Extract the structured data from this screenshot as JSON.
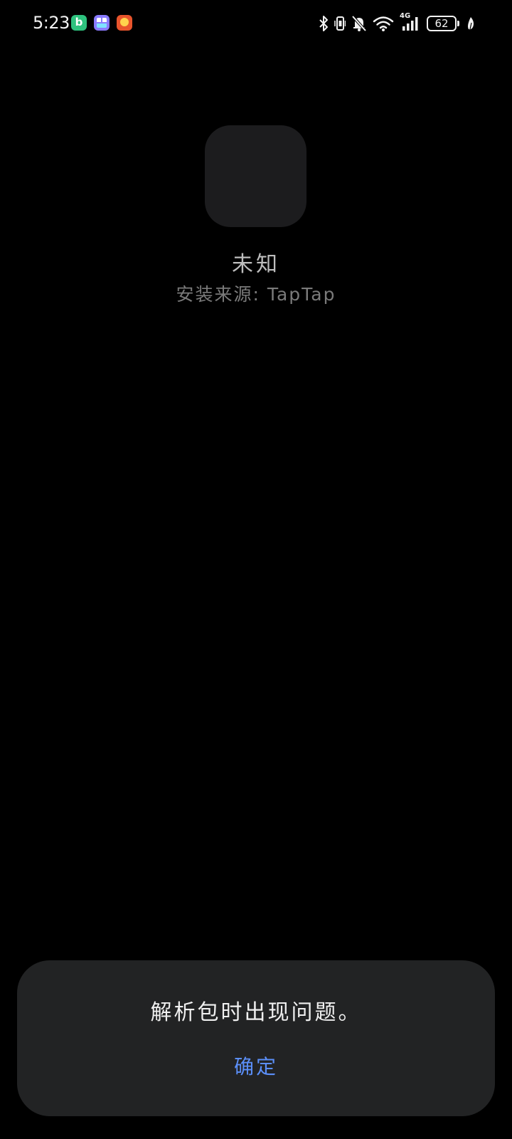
{
  "status_bar": {
    "time": "5:23",
    "notification_icons": [
      "bilibili-icon",
      "gallery-app-icon",
      "game-app-icon"
    ],
    "network_type": "4G",
    "battery_level": "62",
    "system_icons": [
      "bluetooth-icon",
      "vibrate-icon",
      "mute-bell-icon",
      "wifi-icon",
      "cellular-signal-icon",
      "battery-icon",
      "leaf-icon"
    ]
  },
  "app": {
    "name": "未知",
    "install_source": "安装来源: TapTap"
  },
  "dialog": {
    "message": "解析包时出现问题。",
    "confirm_label": "确定"
  },
  "colors": {
    "background": "#000000",
    "dialog_background": "#222324",
    "accent": "#5b8ff9"
  }
}
